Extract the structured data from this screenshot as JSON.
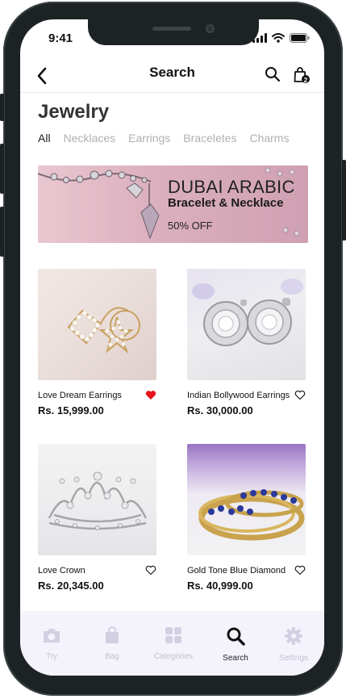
{
  "status": {
    "time": "9:41"
  },
  "header": {
    "title": "Search",
    "bag_count": "2"
  },
  "page_title": "Jewelry",
  "tabs": [
    {
      "label": "All"
    },
    {
      "label": "Necklaces"
    },
    {
      "label": "Earrings"
    },
    {
      "label": "Braceletes"
    },
    {
      "label": "Charms"
    }
  ],
  "banner": {
    "line1": "DUBAI ARABIC",
    "line2": "Bracelet & Necklace",
    "line3": "50% OFF"
  },
  "products": [
    {
      "name": "Love Dream Earrings",
      "price": "Rs. 15,999.00",
      "favorite": true
    },
    {
      "name": "Indian Bollywood Earrings",
      "price": "Rs. 30,000.00",
      "favorite": false
    },
    {
      "name": "Love Crown",
      "price": "Rs. 20,345.00",
      "favorite": false
    },
    {
      "name": "Gold Tone Blue Diamond",
      "price": "Rs. 40,999.00",
      "favorite": false
    }
  ],
  "bottom_nav": [
    {
      "label": "Try",
      "icon": "camera-icon"
    },
    {
      "label": "Bag",
      "icon": "bag-icon"
    },
    {
      "label": "Categories",
      "icon": "grid-icon"
    },
    {
      "label": "Search",
      "icon": "search-icon",
      "active": true
    },
    {
      "label": "Settings",
      "icon": "gear-icon"
    }
  ],
  "colors": {
    "favorite": "#e8141c",
    "inactive_nav": "#c4c0d0",
    "nav_bg": "#f4f2fb"
  }
}
